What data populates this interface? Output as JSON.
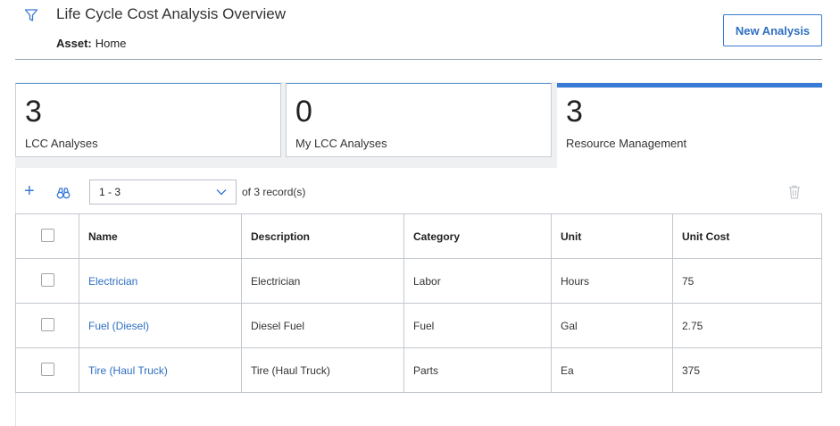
{
  "header": {
    "title": "Life Cycle Cost Analysis Overview",
    "asset_label": "Asset:",
    "asset_value": "Home",
    "new_button": "New Analysis",
    "filter_icon": "filter-icon"
  },
  "tiles": [
    {
      "count": "3",
      "label": "LCC Analyses",
      "active": false
    },
    {
      "count": "0",
      "label": "My LCC Analyses",
      "active": false
    },
    {
      "count": "3",
      "label": "Resource Management",
      "active": true
    }
  ],
  "toolbar": {
    "add_icon": "plus-icon",
    "search_icon": "binoculars-icon",
    "pager_value": "1 - 3",
    "records_text": "of 3 record(s)",
    "delete_icon": "trash-icon"
  },
  "table": {
    "columns": [
      "Name",
      "Description",
      "Category",
      "Unit",
      "Unit Cost"
    ],
    "rows": [
      {
        "name": "Electrician",
        "description": "Electrician",
        "category": "Labor",
        "unit": "Hours",
        "unit_cost": "75"
      },
      {
        "name": "Fuel (Diesel)",
        "description": "Diesel Fuel",
        "category": "Fuel",
        "unit": "Gal",
        "unit_cost": "2.75"
      },
      {
        "name": "Tire (Haul Truck)",
        "description": "Tire (Haul Truck)",
        "category": "Parts",
        "unit": "Ea",
        "unit_cost": "375"
      }
    ]
  },
  "colors": {
    "accent": "#3a7bd5",
    "link": "#2f6fc2",
    "border": "#c3c8ce"
  }
}
